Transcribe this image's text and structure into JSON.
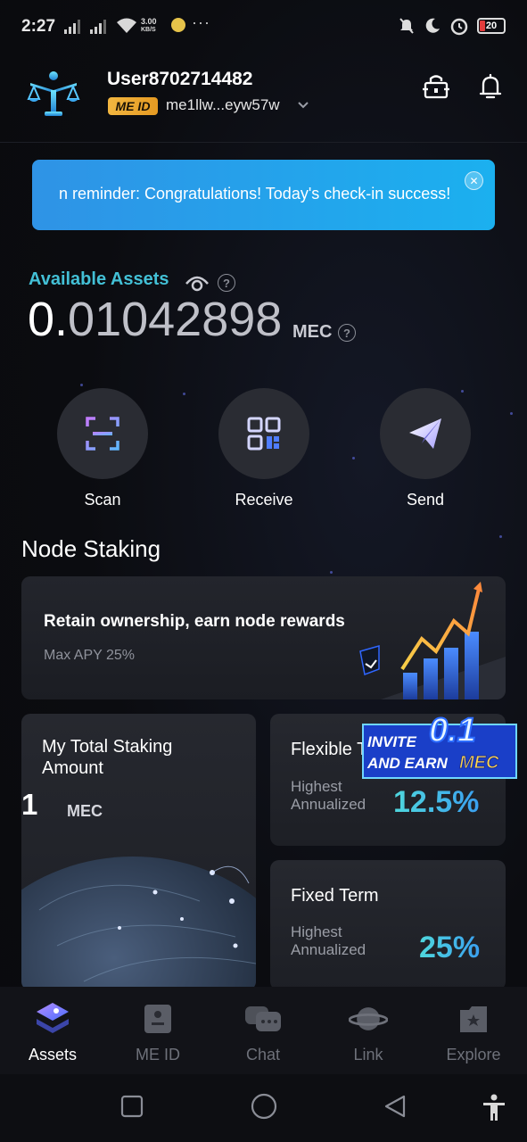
{
  "status_bar": {
    "time": "2:27",
    "net_speed_value": "3.00",
    "net_speed_unit": "KB/S",
    "battery": "20"
  },
  "header": {
    "username": "User8702714482",
    "me_id_badge": "ME ID",
    "address": "me1llw...eyw57w"
  },
  "banner": {
    "text": "n reminder: Congratulations! Today's check-in success!"
  },
  "assets": {
    "label": "Available Assets",
    "balance_lead": "0.",
    "balance_rest": "01042898",
    "unit": "MEC"
  },
  "actions": [
    {
      "label": "Scan",
      "icon": "scan-icon"
    },
    {
      "label": "Receive",
      "icon": "qr-code-icon"
    },
    {
      "label": "Send",
      "icon": "paper-plane-icon"
    }
  ],
  "staking": {
    "section_title": "Node Staking",
    "promo_title": "Retain ownership, earn node rewards",
    "promo_subtitle": "Max APY 25%",
    "total_title": "My Total Staking Amount",
    "total_amount": "1",
    "total_unit": "MEC",
    "flexible_title": "Flexible T",
    "flexible_sub": "Highest Annualized",
    "flexible_pct": "12.5%",
    "fixed_title": "Fixed Term",
    "fixed_sub": "Highest Annualized",
    "fixed_pct": "25%",
    "invite_line1": "INVITE",
    "invite_line2": "AND EARN",
    "invite_amount": "0.1",
    "invite_unit": "MEC"
  },
  "bottom_nav": [
    {
      "label": "Assets",
      "icon": "assets-icon",
      "active": true
    },
    {
      "label": "ME ID",
      "icon": "id-card-icon",
      "active": false
    },
    {
      "label": "Chat",
      "icon": "chat-icon",
      "active": false
    },
    {
      "label": "Link",
      "icon": "planet-icon",
      "active": false
    },
    {
      "label": "Explore",
      "icon": "explore-icon",
      "active": false
    }
  ],
  "colors": {
    "accent_teal": "#43c0d6",
    "banner_blue": "#1bb0ef",
    "badge_gold": "#f2b640",
    "background": "#0b0c10"
  }
}
